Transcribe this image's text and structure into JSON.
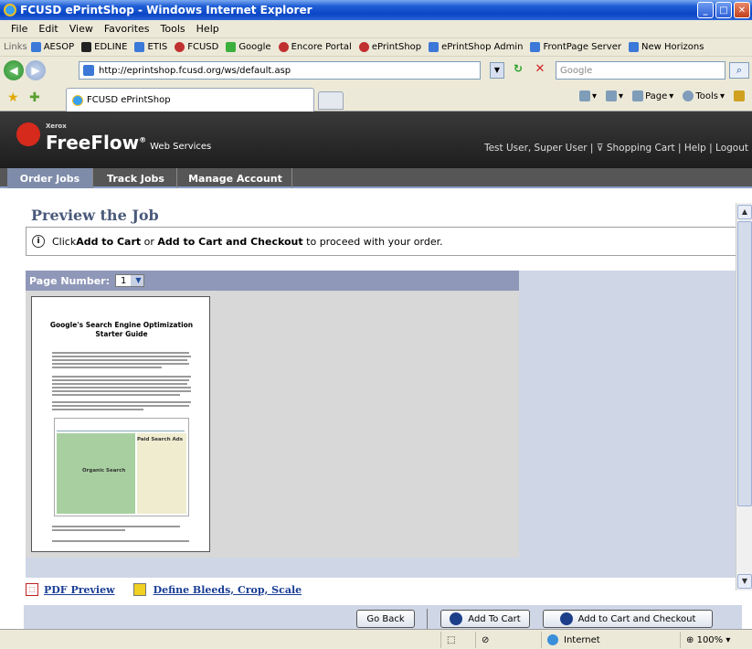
{
  "window": {
    "title": "FCUSD ePrintShop - Windows Internet Explorer"
  },
  "menu": [
    "File",
    "Edit",
    "View",
    "Favorites",
    "Tools",
    "Help"
  ],
  "links_bar": {
    "label": "Links",
    "items": [
      "AESOP",
      "EDLINE",
      "ETIS",
      "FCUSD",
      "Google",
      "Encore Portal",
      "ePrintShop",
      "ePrintShop Admin",
      "FrontPage Server",
      "New Horizons"
    ]
  },
  "address": {
    "url": "http://eprintshop.fcusd.org/ws/default.asp",
    "search_placeholder": "Google"
  },
  "tab": {
    "title": "FCUSD ePrintShop"
  },
  "command_bar": {
    "page": "Page",
    "tools": "Tools"
  },
  "app": {
    "brand_small": "Xerox",
    "brand": "FreeFlow",
    "brand_suffix": "Web Services",
    "user_links": "Test User, Super User | ⊽ Shopping Cart | Help | Logout",
    "nav": [
      "Order Jobs",
      "Track Jobs",
      "Manage Account"
    ]
  },
  "content": {
    "title": "Preview the Job",
    "info_prefix": "Click ",
    "info_b1": "Add to Cart",
    "info_mid": " or ",
    "info_b2": "Add to Cart and Checkout",
    "info_suffix": " to proceed with your order.",
    "page_number_label": "Page Number:",
    "page_number_value": "1",
    "doc_title": "Google's Search Engine Optimization Starter Guide",
    "doc_label_1": "Paid Search Ads",
    "doc_label_2": "Organic Search",
    "pdf_preview": "PDF Preview",
    "define_bleeds": "Define Bleeds, Crop, Scale",
    "go_back": "Go Back",
    "add_to_cart": "Add To Cart",
    "add_checkout": "Add to Cart and Checkout"
  },
  "status": {
    "zone": "Internet",
    "zoom": "100%"
  }
}
